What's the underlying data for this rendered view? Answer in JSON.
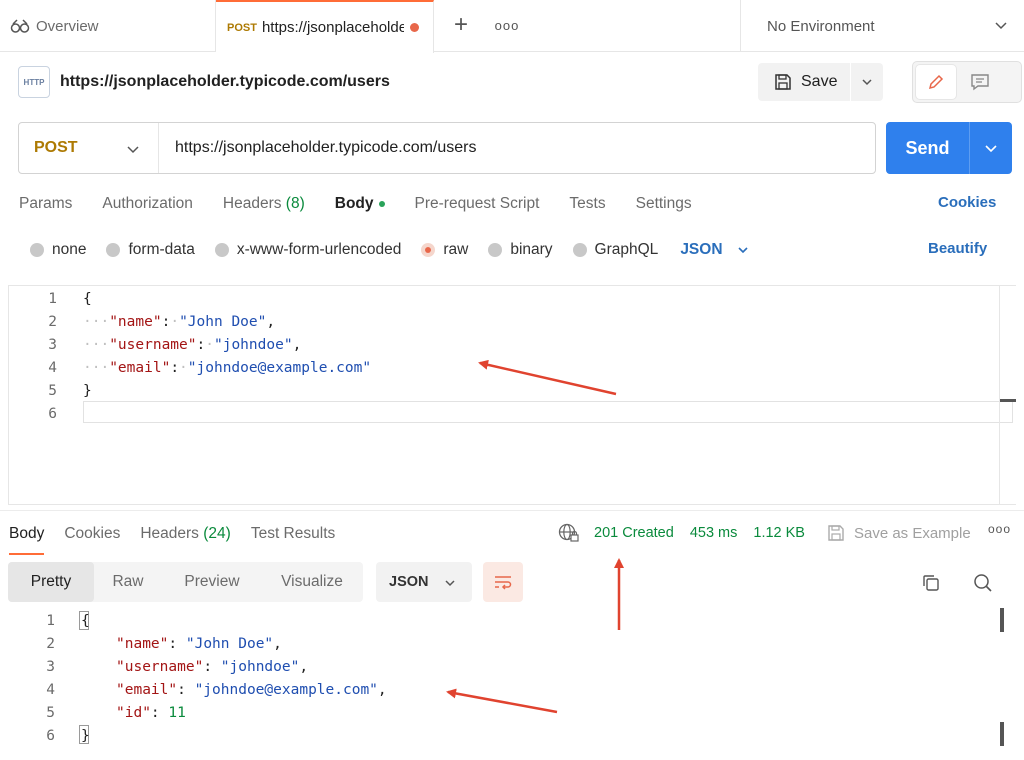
{
  "tabs": {
    "overview_label": "Overview",
    "active_method": "POST",
    "active_url": "https://jsonplaceholder.typicode.com/users",
    "environment": "No Environment"
  },
  "request": {
    "title": "https://jsonplaceholder.typicode.com/users",
    "save_label": "Save",
    "method": "POST",
    "url": "https://jsonplaceholder.typicode.com/users",
    "send_label": "Send",
    "http_badge": "HTTP"
  },
  "request_tabs": [
    {
      "label": "Params"
    },
    {
      "label": "Authorization"
    },
    {
      "label": "Headers",
      "count": "(8)"
    },
    {
      "label": "Body"
    },
    {
      "label": "Pre-request Script"
    },
    {
      "label": "Tests"
    },
    {
      "label": "Settings"
    }
  ],
  "cookies_label": "Cookies",
  "body_types": [
    "none",
    "form-data",
    "x-www-form-urlencoded",
    "raw",
    "binary",
    "GraphQL"
  ],
  "selected_body_type": "raw",
  "language": "JSON",
  "beautify_label": "Beautify",
  "request_body": {
    "line_numbers": [
      "1",
      "2",
      "3",
      "4",
      "5",
      "6"
    ],
    "open": "{",
    "close": "}",
    "fields": [
      {
        "key": "\"name\"",
        "value": "\"John Doe\"",
        "sep": ","
      },
      {
        "key": "\"username\"",
        "value": "\"johndoe\"",
        "sep": ","
      },
      {
        "key": "\"email\"",
        "value": "\"johndoe@example.com\"",
        "sep": ""
      }
    ]
  },
  "response": {
    "tabs": [
      {
        "label": "Body"
      },
      {
        "label": "Cookies"
      },
      {
        "label": "Headers",
        "count": "(24)"
      },
      {
        "label": "Test Results"
      }
    ],
    "status": "201 Created",
    "time": "453 ms",
    "size": "1.12 KB",
    "save_example": "Save as Example",
    "view_tabs": [
      "Pretty",
      "Raw",
      "Preview",
      "Visualize"
    ],
    "format": "JSON",
    "line_numbers": [
      "1",
      "2",
      "3",
      "4",
      "5",
      "6"
    ],
    "open": "{",
    "close": "}",
    "fields": [
      {
        "key": "\"name\"",
        "value": "\"John Doe\"",
        "sep": ",",
        "type": "string"
      },
      {
        "key": "\"username\"",
        "value": "\"johndoe\"",
        "sep": ",",
        "type": "string"
      },
      {
        "key": "\"email\"",
        "value": "\"johndoe@example.com\"",
        "sep": ",",
        "type": "string"
      },
      {
        "key": "\"id\"",
        "value": "11",
        "sep": "",
        "type": "number"
      }
    ]
  },
  "colors": {
    "accent": "#ff6c37",
    "send_blue": "#2f80ed",
    "status_green": "#0a8a3c",
    "post_method": "#ad7a03",
    "annotation_arrow": "#e0432f"
  }
}
